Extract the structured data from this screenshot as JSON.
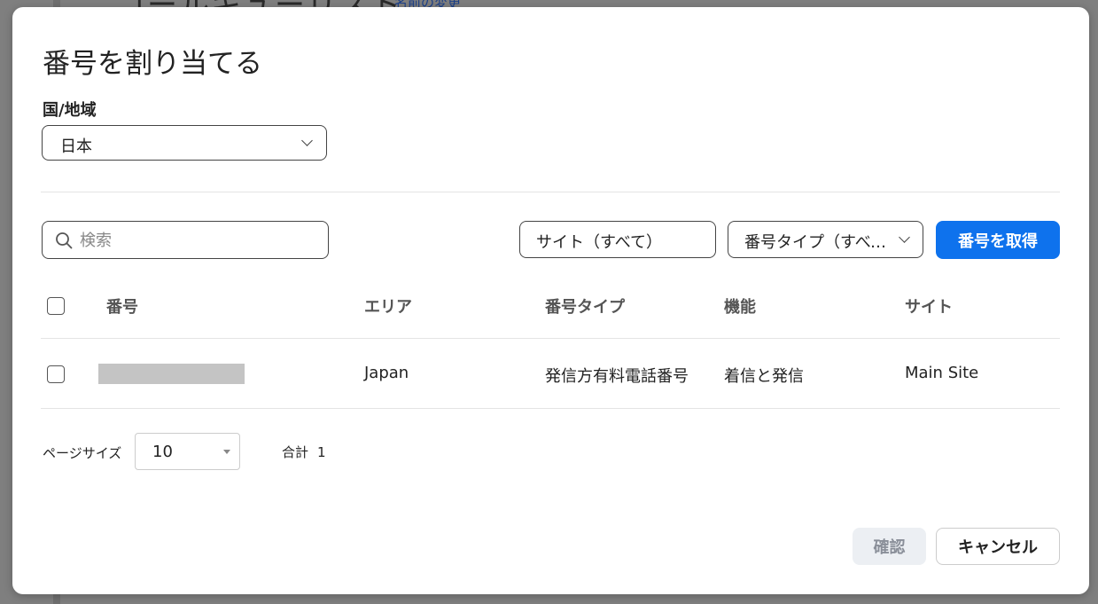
{
  "background": {
    "title_fragment": "コールキューリスト",
    "link_fragment": "名前の変更"
  },
  "dialog": {
    "title": "番号を割り当てる",
    "region": {
      "label": "国/地域",
      "value": "日本"
    },
    "search": {
      "placeholder": "検索",
      "value": ""
    },
    "filters": {
      "site": "サイト（すべて）",
      "number_type": "番号タイプ（すべて）"
    },
    "get_number_button": "番号を取得",
    "table": {
      "columns": [
        "番号",
        "エリア",
        "番号タイプ",
        "機能",
        "サイト"
      ],
      "rows": [
        {
          "number": "",
          "area": "Japan",
          "number_type": "発信方有料電話番号",
          "capability": "着信と発信",
          "site": "Main Site",
          "checked": false
        }
      ]
    },
    "pagination": {
      "page_size_label": "ページサイズ",
      "page_size": "10",
      "total_label": "合計",
      "total": "1"
    },
    "footer": {
      "confirm": "確認",
      "cancel": "キャンセル"
    },
    "colors": {
      "primary": "#0e72ed",
      "overlay": "#7f7f7f",
      "confirm_disabled_bg": "#eceff3"
    }
  }
}
